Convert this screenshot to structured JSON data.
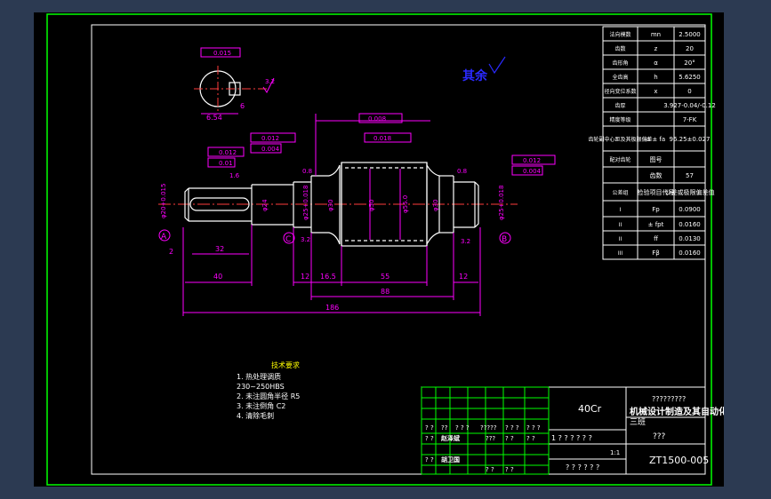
{
  "tech_requirements": {
    "title": "技术要求",
    "items": [
      "1. 热处理调质",
      "230~250HBS",
      "2. 未注圆角半径 R5",
      "3. 未注倒角 C2",
      "4. 清除毛刺"
    ]
  },
  "roughness_note": "其余",
  "gear_table": [
    [
      "法向模数",
      "mn",
      "2.5000"
    ],
    [
      "齿数",
      "z",
      "20"
    ],
    [
      "齿形角",
      "α",
      "20°"
    ],
    [
      "全齿高",
      "h",
      "5.6250"
    ],
    [
      "径向变位系数",
      "x",
      "0"
    ],
    [
      "齿厚",
      "",
      "3.927-0.04/-0.12"
    ],
    [
      "精度等级",
      "",
      "7-FK"
    ],
    [
      "齿轮副中心距及其极限偏差",
      "a ± fa",
      "96.25±0.027"
    ],
    [
      "配对齿轮",
      "图号",
      ""
    ],
    [
      "",
      "齿数",
      "57"
    ],
    [
      "公差组",
      "检验项目代号",
      "公差或极限偏差值"
    ],
    [
      "I",
      "Fp",
      "0.0900"
    ],
    [
      "II",
      "± fpt",
      "0.0160"
    ],
    [
      "II",
      "ff",
      "0.0130"
    ],
    [
      "III",
      "Fβ",
      "0.0160"
    ]
  ],
  "title_block": {
    "material": "40Cr",
    "unknown_top": "?????????",
    "org_line1": "机械设计制造及其自动化",
    "org_line2": "三班",
    "part_name": "???",
    "drawing_no": "ZT1500-005",
    "scale": "1:1",
    "sheet": "? ? 1 ? ? ?",
    "row1": [
      "? ?",
      "??",
      "? ? ?",
      "?????",
      "? ? ?",
      "? ? ?"
    ],
    "row2": [
      "? ?",
      "赵泽斌",
      "???",
      "? ?",
      "? ?"
    ],
    "row3": [
      "? ?",
      "胡卫国",
      "? ?",
      "? ?"
    ],
    "mass_row": "1 ? ? ?   ?   ? ?",
    "sheet_row": "? ? ?   ? ? ?"
  },
  "dimensions": {
    "length_total": "186",
    "length_mid": "88",
    "length_teeth": "55",
    "len_12a": "12",
    "len_16_5": "16.5",
    "len_12b": "12",
    "len_12c": "12",
    "len_40": "40",
    "len_32": "32",
    "len_2": "2",
    "dia_left": "φ20+0.015",
    "dia_shaft": "φ24",
    "dia_journal_l": "φ25+0.018",
    "dia_30a": "φ30",
    "dia_50": "φ50",
    "dia_55": "φ55.0",
    "dia_30b": "φ30",
    "dia_journal_r": "φ25+0.018",
    "section_16": "6.54",
    "section_width": "6",
    "ra_32a": "3.2",
    "ra_32b": "3.2",
    "ra_08a": "0.8",
    "ra_08b": "0.8",
    "ra_16": "1.6",
    "ra_32c": "3.2",
    "datum_a": "A",
    "datum_b": "B",
    "datum_c": "C"
  },
  "tolerances": {
    "tol_sym": "0.015",
    "tol_runout_a": "0.012",
    "tol_cyl_a": "0.01",
    "tol_runout_c": "0.012",
    "tol_cyl_c": "0.004",
    "tol_runout_b": "0.008",
    "tol_runout_gear": "0.018",
    "tol_runout_r": "0.012",
    "tol_cyl_r": "0.004"
  },
  "colors": {
    "background": "#2c3a52",
    "sheet": "#000000",
    "frame": "#00ff00",
    "lines": "#ffffff",
    "dims": "#ff00ff",
    "center": "#ff3b3b",
    "note": "#2a2aff"
  }
}
